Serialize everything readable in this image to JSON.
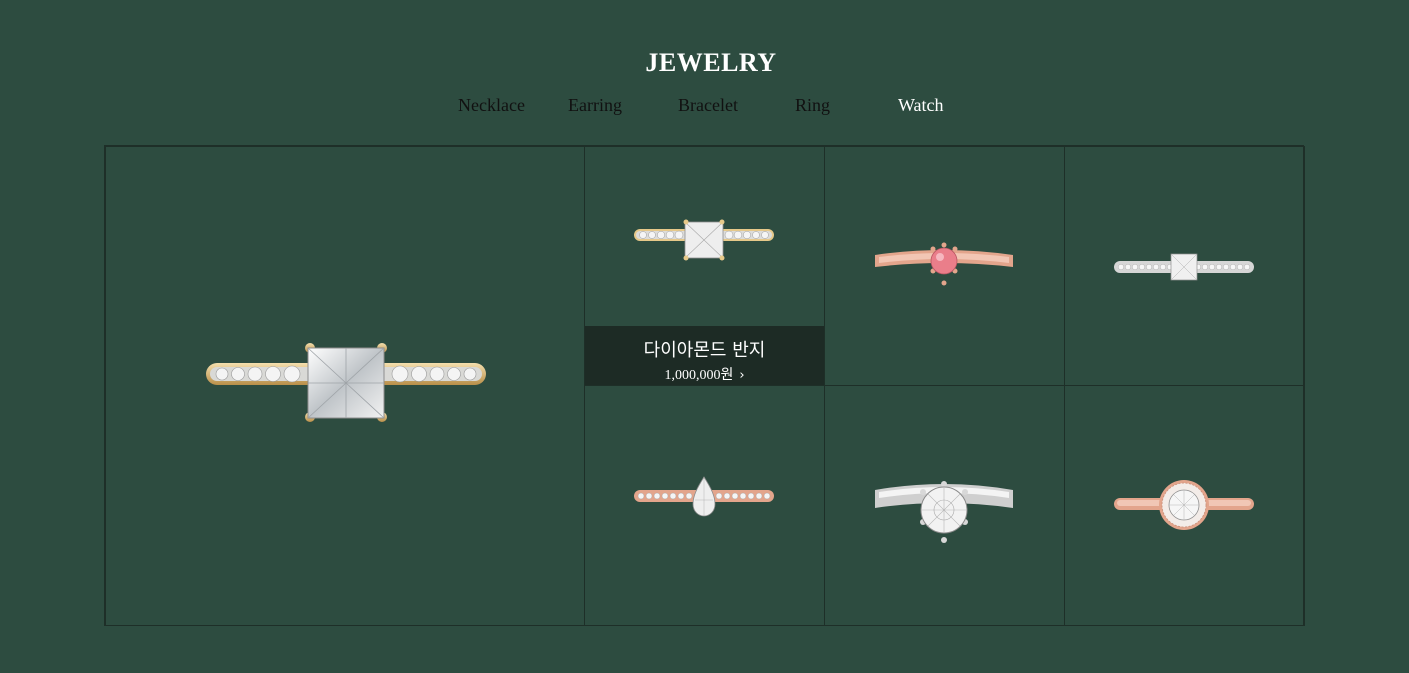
{
  "header": {
    "title": "JEWELRY"
  },
  "nav": {
    "items": [
      {
        "label": "Necklace"
      },
      {
        "label": "Earring"
      },
      {
        "label": "Bracelet"
      },
      {
        "label": "Ring"
      },
      {
        "label": "Watch"
      }
    ]
  },
  "products": {
    "hover": {
      "name": "다이아몬드 반지",
      "price": "1,000,000원"
    },
    "items": [
      {
        "icon": "gold-princess-diamond-ring-icon"
      },
      {
        "icon": "gold-princess-diamond-ring-icon"
      },
      {
        "icon": "rose-gold-pink-solitaire-ring-icon"
      },
      {
        "icon": "white-gold-princess-pave-ring-icon"
      },
      {
        "icon": "rose-gold-pear-diamond-ring-icon"
      },
      {
        "icon": "silver-solitaire-diamond-ring-icon"
      },
      {
        "icon": "rose-gold-halo-diamond-ring-icon"
      }
    ]
  },
  "colors": {
    "background": "#2d4c40",
    "grid_border": "#1e2f28",
    "overlay": "#1d2b25",
    "gold": "#e6c98a",
    "rose_gold": "#e3a58c",
    "silver": "#dcdcdc",
    "pink_stone": "#ea7e8a"
  }
}
